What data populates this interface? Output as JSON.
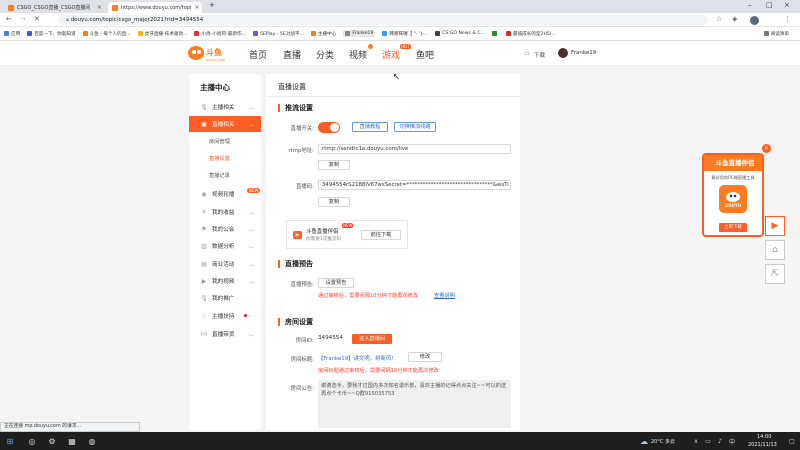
{
  "browser": {
    "tabs": [
      {
        "title": "CSGO_CSGO直播_CSGO直播间",
        "active": false
      },
      {
        "title": "https://www.douyu.com/topi",
        "active": true
      }
    ],
    "new_tab_glyph": "+",
    "url": "douyu.com/topic/csgo_major2021?rid=3494554",
    "bookmarks": [
      "应用",
      "百度一下，你就知道",
      "斗鱼 - 每个人的直...",
      "虎牙直播-技术驱动...",
      "小尚-小尚阿-最新作...",
      "5EPlay - 5E对战平...",
      "主播中心",
      "Franke19",
      "韩哪阵喔【 \"- ')-...",
      "CS:GO News & C...",
      "",
      "最诚成长的型2H5I...",
      "阅读清单"
    ]
  },
  "site": {
    "nav": [
      "首页",
      "直播",
      "分类",
      "视频",
      "游戏",
      "鱼吧"
    ],
    "hot_badge": "HOT",
    "download": "下载",
    "username": "Franke19"
  },
  "sidebar": {
    "title": "主播中心",
    "items": [
      {
        "label": "主播相关",
        "icon": "mic-icon"
      },
      {
        "label": "直播相关",
        "icon": "tv-icon",
        "active": true
      },
      {
        "label": "视频轮播",
        "icon": "video-icon",
        "badge": "NEW"
      },
      {
        "label": "我的收益",
        "icon": "money-icon"
      },
      {
        "label": "我的公会",
        "icon": "guild-icon"
      },
      {
        "label": "数据分析",
        "icon": "chart-icon"
      },
      {
        "label": "商业活动",
        "icon": "gift-icon"
      },
      {
        "label": "我的视频",
        "icon": "film-icon"
      },
      {
        "label": "我的推广",
        "icon": "mic2-icon"
      },
      {
        "label": "主播扶持",
        "icon": "support-icon",
        "dot": true
      },
      {
        "label": "直播带货",
        "icon": "like-icon"
      }
    ],
    "sub_items": [
      "房间管理",
      "直播设置",
      "直播记录"
    ]
  },
  "main": {
    "title": "直播设置",
    "stream": {
      "section": "推流设置",
      "switch_label": "直播开关:",
      "tutorial": "直播教程",
      "recording": "切换推流线路",
      "rtmp_label": "rtmp地址:",
      "rtmp_value": "rtmp://sendtc1a.douyu.com/live",
      "copy": "复制",
      "code_label": "直播码:",
      "code_value": "3494554rS2188IV67wsSecret=********************************&wsTi",
      "app_name": "斗鱼直播伴侣",
      "app_sub": "你需要1次推流码",
      "app_new": "NEW",
      "app_open": "前往下载"
    },
    "preview": {
      "section": "直播预告",
      "label": "直播预告:",
      "btn": "设置预告",
      "note": "通过审核后，需要间隔10分钟才能再次修改",
      "link": "查看说明"
    },
    "room": {
      "section": "房间设置",
      "id_label": "房间ID:",
      "id_value": "3494554",
      "enter_btn": "进入直播间",
      "title_label": "房间标题:",
      "title_value": "【Franke19】讲文明，树新风!",
      "modify": "修改",
      "title_note": "房间标题通过审核后，需要间隔10分钟才能再次修改",
      "notice_label": "房间公告:",
      "notice_value": "谢谢选手，要我才过国内多次知名退乐部，喜欢主播的记得点点关注~~可以的送再点个卡币~~Q群915035753"
    }
  },
  "promo": {
    "title": "斗鱼直播伴侣",
    "sub": "最好用的PC端直播工具",
    "logo": "DOUYU",
    "btn": "立即下载",
    "close": "×"
  },
  "status_bar": "正在连接 mp.douyu.com 的请求...",
  "taskbar": {
    "weather": "20°C 多云",
    "time": "14:00",
    "date": "2021/11/13"
  },
  "colors": {
    "accent": "#ff5d23",
    "link": "#2e6fcc"
  }
}
